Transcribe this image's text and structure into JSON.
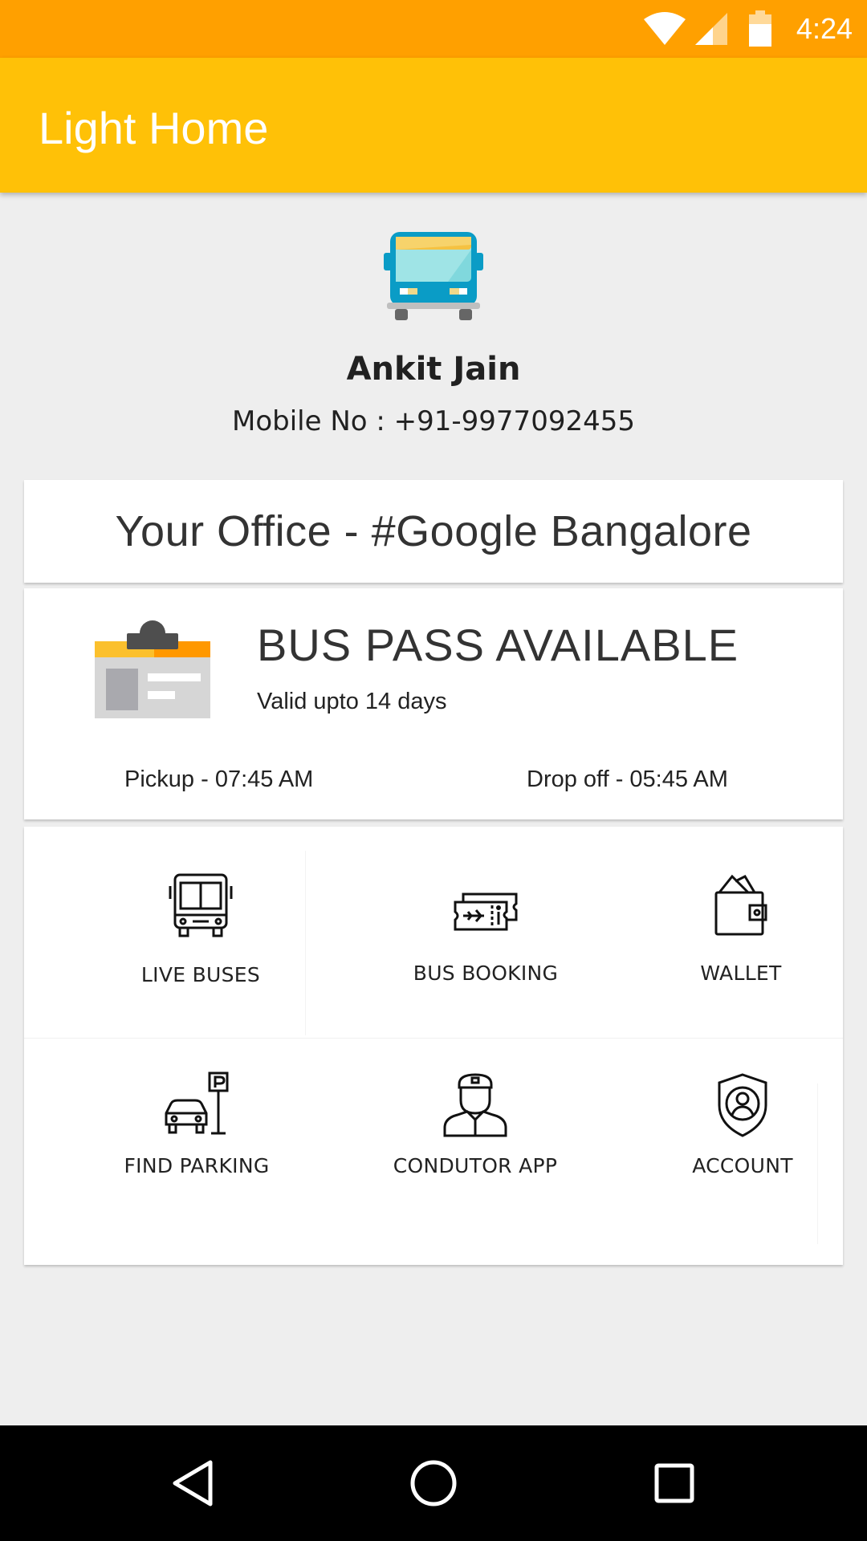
{
  "status_bar": {
    "time": "4:24",
    "bar_color": "#ffa000"
  },
  "app_bar": {
    "title": "Light Home",
    "color": "#ffc107"
  },
  "profile": {
    "name": "Ankit Jain",
    "mobile": "Mobile No : +91-9977092455"
  },
  "office": {
    "text": "Your Office - #Google Bangalore"
  },
  "bus_pass": {
    "title": "BUS PASS AVAILABLE",
    "validity": "Valid upto 14 days",
    "pickup": "Pickup - 07:45 AM",
    "dropoff": "Drop off - 05:45 AM"
  },
  "menu": [
    {
      "label": "LIVE BUSES",
      "icon": "bus-icon"
    },
    {
      "label": "BUS BOOKING",
      "icon": "ticket-icon"
    },
    {
      "label": "WALLET",
      "icon": "wallet-icon"
    },
    {
      "label": "FIND PARKING",
      "icon": "parking-icon"
    },
    {
      "label": "CONDUTOR APP",
      "icon": "conductor-icon"
    },
    {
      "label": "ACCOUNT",
      "icon": "account-shield-icon"
    }
  ],
  "nav": {
    "back": "back-icon",
    "home": "home-icon",
    "recents": "recents-icon"
  }
}
